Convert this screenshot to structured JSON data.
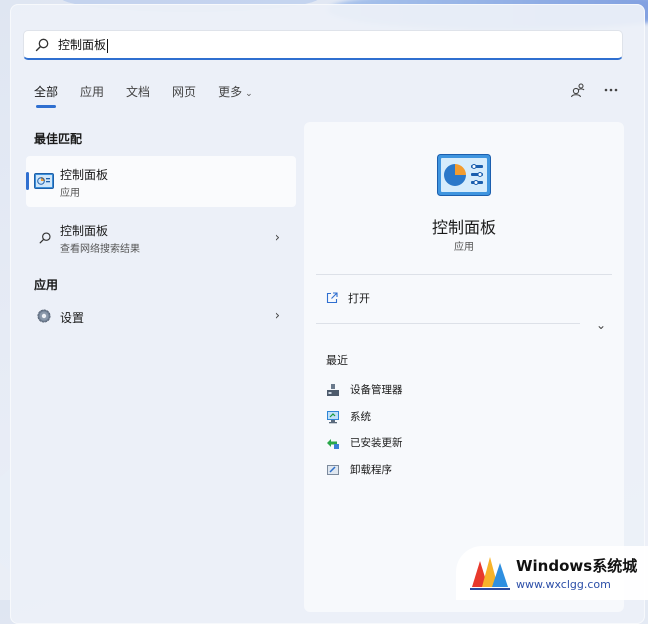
{
  "search": {
    "query": "控制面板"
  },
  "filters": {
    "tabs": [
      "全部",
      "应用",
      "文档",
      "网页",
      "更多"
    ],
    "active": "全部"
  },
  "left": {
    "best_match_label": "最佳匹配",
    "best_match": {
      "title": "控制面板",
      "subtitle": "应用"
    },
    "web_result": {
      "title": "控制面板",
      "subtitle": "查看网络搜索结果"
    },
    "apps_label": "应用",
    "apps": [
      {
        "title": "设置"
      }
    ]
  },
  "detail": {
    "title": "控制面板",
    "type": "应用",
    "open_label": "打开",
    "recent_label": "最近",
    "recent": [
      {
        "label": "设备管理器",
        "icon": "device-manager-icon"
      },
      {
        "label": "系统",
        "icon": "system-icon"
      },
      {
        "label": "已安装更新",
        "icon": "installed-updates-icon"
      },
      {
        "label": "卸载程序",
        "icon": "uninstall-program-icon"
      }
    ]
  },
  "watermark": {
    "line1": "Windows系统城",
    "line2": "www.wxclgg.com"
  },
  "colors": {
    "accent": "#2f6fd0"
  }
}
